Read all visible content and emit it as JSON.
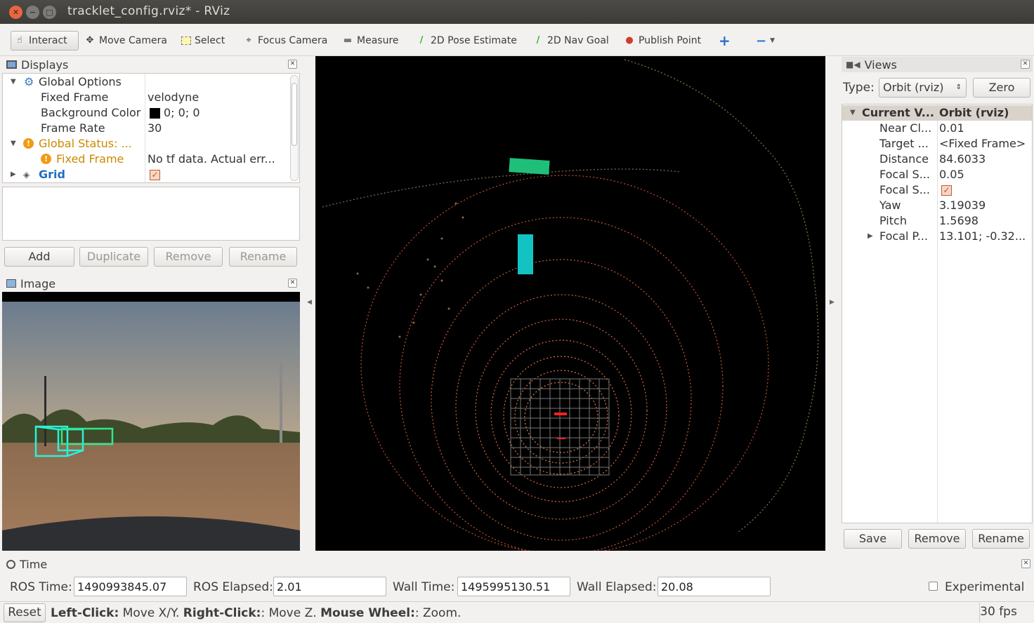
{
  "window": {
    "title": "tracklet_config.rviz* - RViz"
  },
  "toolbar": {
    "interact": "Interact",
    "move_camera": "Move Camera",
    "select": "Select",
    "focus_camera": "Focus Camera",
    "measure": "Measure",
    "pose_estimate": "2D Pose Estimate",
    "nav_goal": "2D Nav Goal",
    "publish_point": "Publish Point",
    "add_tool": "+",
    "remove_tool": "−"
  },
  "displays": {
    "title": "Displays",
    "rows": [
      {
        "name": "Global Options",
        "value": ""
      },
      {
        "name": "Fixed Frame",
        "value": "velodyne"
      },
      {
        "name": "Background Color",
        "value": "0; 0; 0"
      },
      {
        "name": "Frame Rate",
        "value": "30"
      },
      {
        "name": "Global Status: ...",
        "value": ""
      },
      {
        "name": "Fixed Frame",
        "value": "No tf data.  Actual err..."
      },
      {
        "name": "Grid",
        "value": ""
      }
    ],
    "buttons": {
      "add": "Add",
      "duplicate": "Duplicate",
      "remove": "Remove",
      "rename": "Rename"
    }
  },
  "image_panel": {
    "title": "Image"
  },
  "views": {
    "title": "Views",
    "type_label": "Type:",
    "type_value": "Orbit (rviz)",
    "zero": "Zero",
    "rows": [
      {
        "name": "Current V...",
        "value": "Orbit (rviz)"
      },
      {
        "name": "Near Cl...",
        "value": "0.01"
      },
      {
        "name": "Target ...",
        "value": "<Fixed Frame>"
      },
      {
        "name": "Distance",
        "value": "84.6033"
      },
      {
        "name": "Focal S...",
        "value": "0.05"
      },
      {
        "name": "Focal S...",
        "value": ""
      },
      {
        "name": "Yaw",
        "value": "3.19039"
      },
      {
        "name": "Pitch",
        "value": "1.5698"
      },
      {
        "name": "Focal P...",
        "value": "13.101; -0.32..."
      }
    ],
    "buttons": {
      "save": "Save",
      "remove": "Remove",
      "rename": "Rename"
    }
  },
  "time": {
    "title": "Time",
    "ros_time_label": "ROS Time:",
    "ros_time": "1490993845.07",
    "ros_elapsed_label": "ROS Elapsed:",
    "ros_elapsed": "2.01",
    "wall_time_label": "Wall Time:",
    "wall_time": "1495995130.51",
    "wall_elapsed_label": "Wall Elapsed:",
    "wall_elapsed": "20.08",
    "experimental": "Experimental"
  },
  "status": {
    "reset": "Reset",
    "left_click": "Left-Click:",
    "left_click_desc": " Move X/Y. ",
    "right_click": "Right-Click:",
    "right_click_desc": ": Move Z. ",
    "wheel": "Mouse Wheel:",
    "wheel_desc": ": Zoom.",
    "fps": "30 fps"
  },
  "colors": {
    "accent_orange": "#cc8a00",
    "link_blue": "#1e6fc2",
    "background": "#000000"
  }
}
